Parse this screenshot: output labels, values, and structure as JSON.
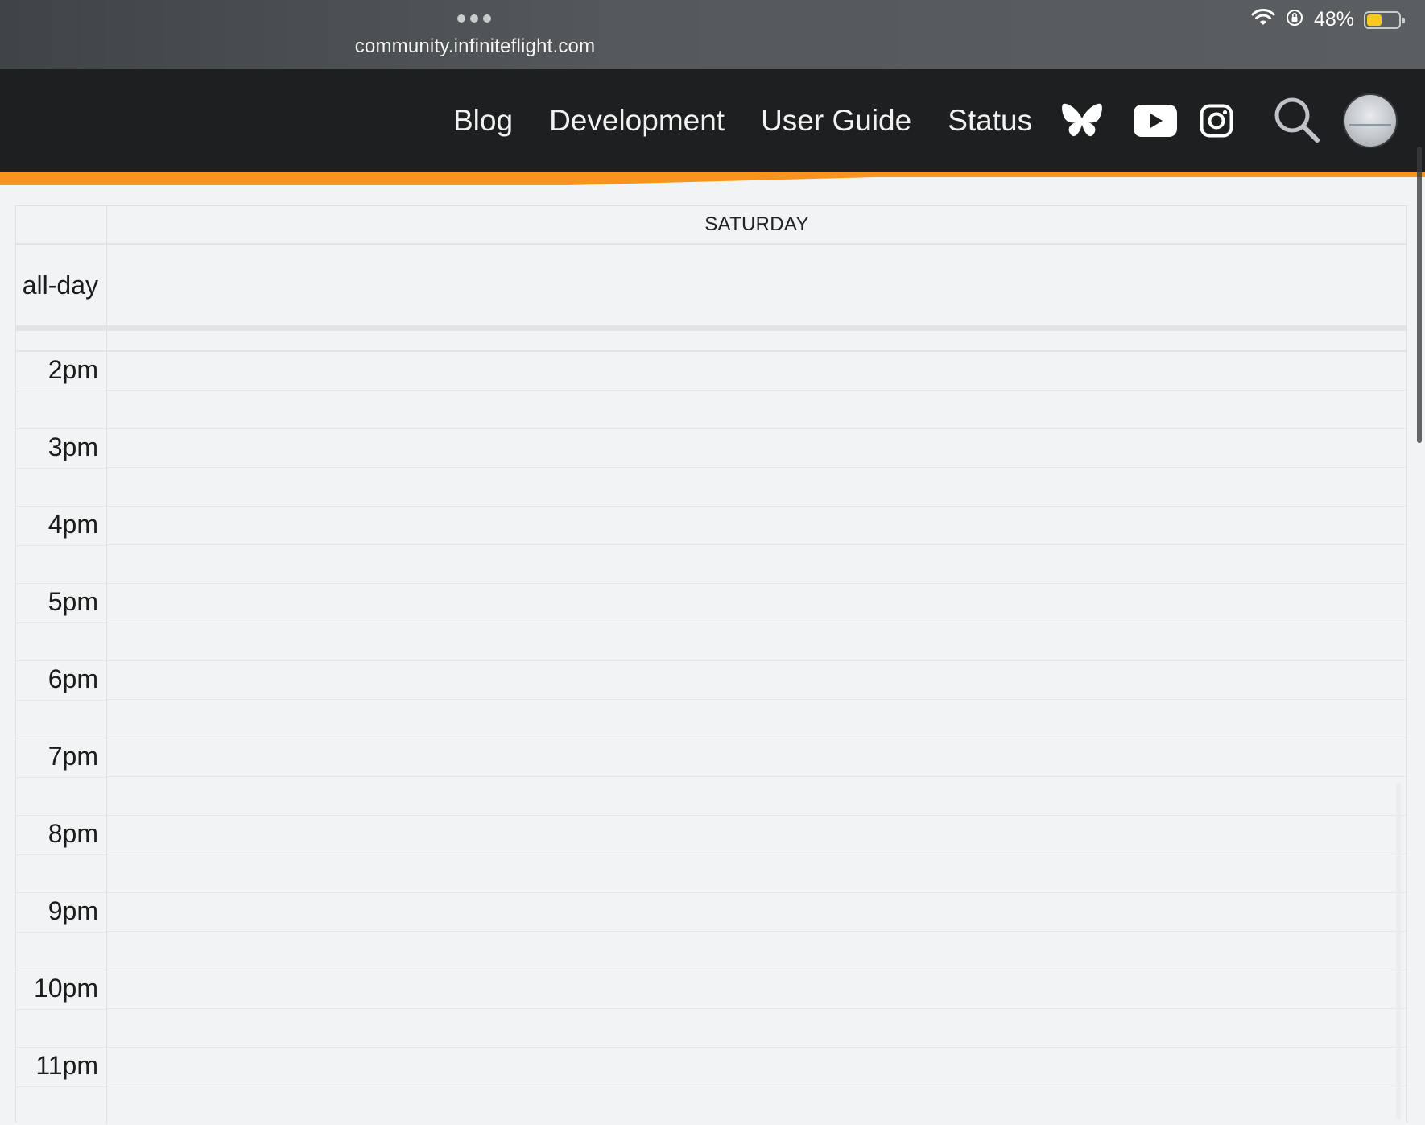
{
  "browser": {
    "url": "community.infiniteflight.com",
    "battery_percent": "48%",
    "battery_level": 0.48
  },
  "nav": {
    "links": [
      "Blog",
      "Development",
      "User Guide",
      "Status"
    ],
    "icons": [
      "butterfly-icon",
      "youtube-icon",
      "instagram-icon",
      "search-icon"
    ],
    "accent_color": "#f7941d",
    "background_color": "#1d1f21"
  },
  "calendar": {
    "day_header": "SATURDAY",
    "allday_label": "all-day",
    "hours": [
      "2pm",
      "3pm",
      "4pm",
      "5pm",
      "6pm",
      "7pm",
      "8pm",
      "9pm",
      "10pm",
      "11pm"
    ]
  }
}
